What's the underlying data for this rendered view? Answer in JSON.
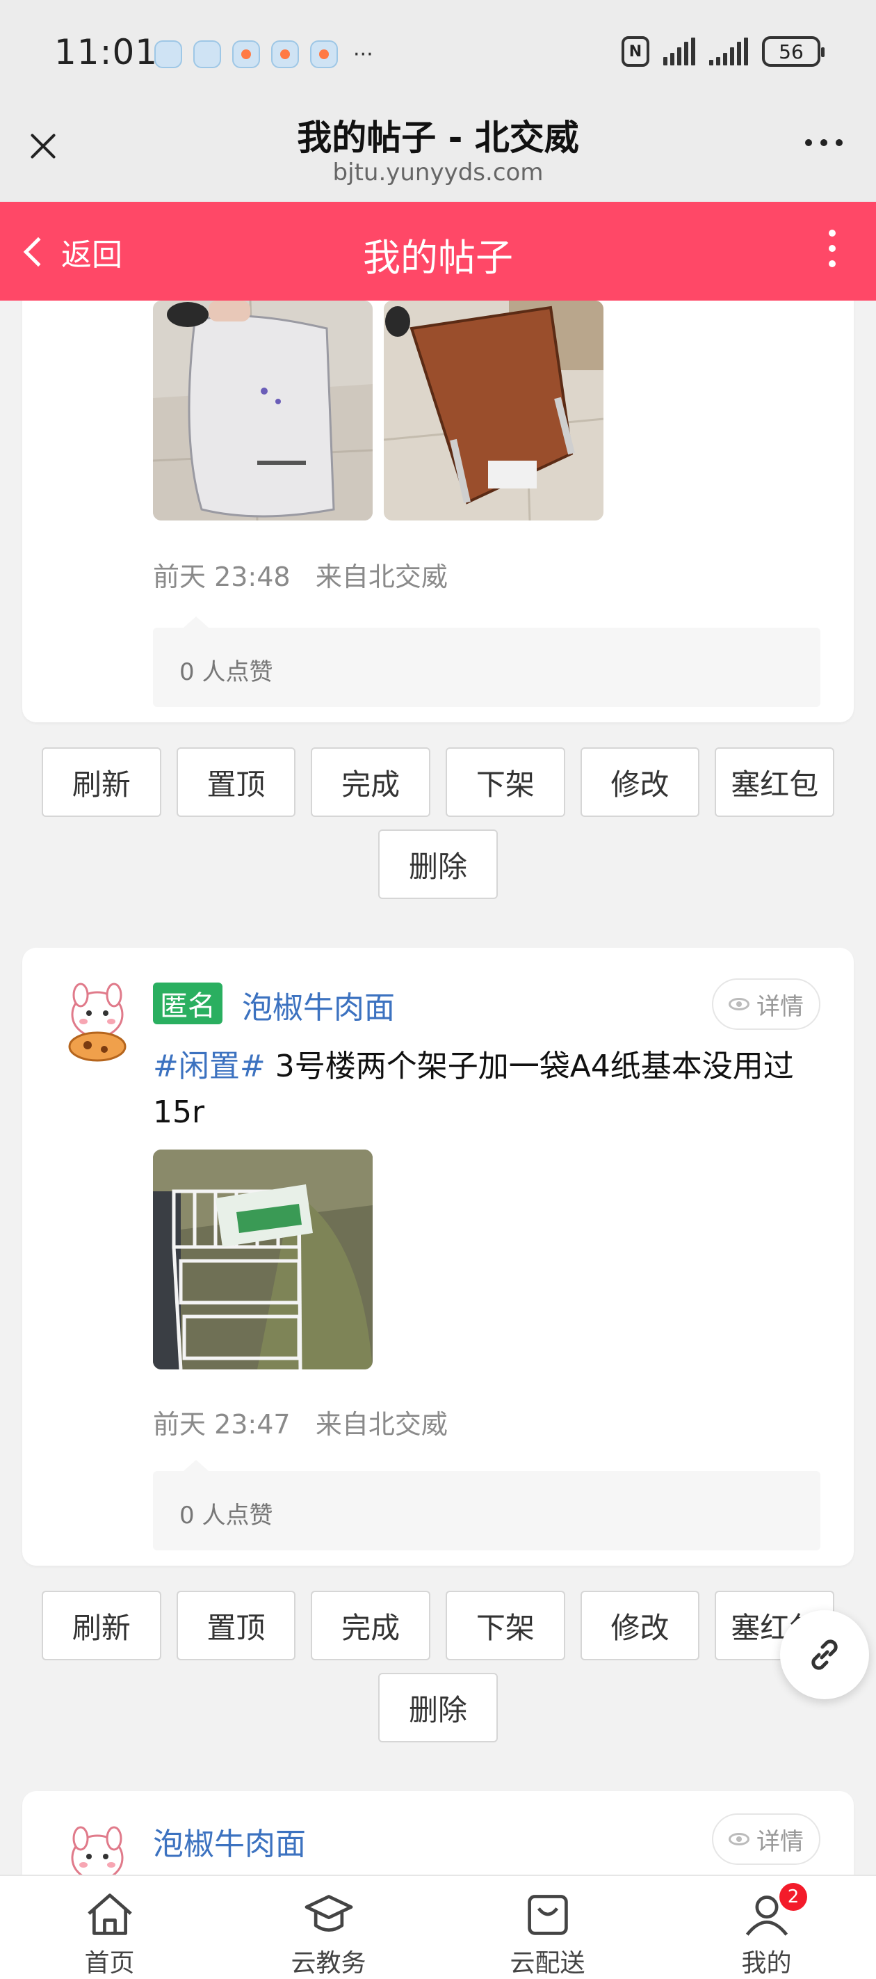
{
  "status_bar": {
    "time": "11:01",
    "more": "···",
    "nfc": "N",
    "battery": "56"
  },
  "browser": {
    "title": "我的帖子 - 北交威",
    "url": "bjtu.yunyyds.com"
  },
  "header": {
    "back_label": "返回",
    "title": "我的帖子"
  },
  "posts": [
    {
      "time": "前天 23:48",
      "source": "来自北交威",
      "likes": "0 人点赞"
    },
    {
      "anon_label": "匿名",
      "author": "泡椒牛肉面",
      "detail_label": "详情",
      "hashtag": "#闲置#",
      "text": " 3号楼两个架子加一袋A4纸基本没用过15r",
      "time": "前天 23:47",
      "source": "来自北交威",
      "likes": "0 人点赞"
    },
    {
      "author": "泡椒牛肉面",
      "detail_label": "详情"
    }
  ],
  "actions": {
    "refresh": "刷新",
    "pin": "置顶",
    "done": "完成",
    "offshelf": "下架",
    "edit": "修改",
    "redpacket": "塞红包",
    "delete": "删除"
  },
  "nav": {
    "home": "首页",
    "academic": "云教务",
    "delivery": "云配送",
    "mine": "我的",
    "mine_badge": "2"
  },
  "colors": {
    "accent": "#ff4867",
    "link": "#3c72c0",
    "anon_badge": "#2aaf60"
  }
}
